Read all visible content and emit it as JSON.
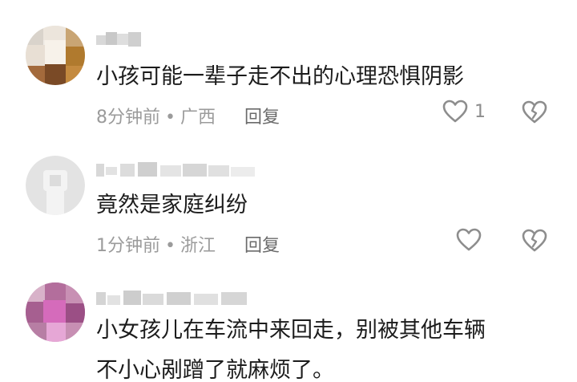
{
  "comments": [
    {
      "text": "小孩可能一辈子走不出的心理恐惧阴影",
      "time": "8分钟前",
      "location": "广西",
      "reply_label": "回复",
      "likes": "1"
    },
    {
      "text": "竟然是家庭纠纷",
      "time": "1分钟前",
      "location": "浙江",
      "reply_label": "回复",
      "likes": ""
    },
    {
      "text_line1": "小女孩儿在车流中来回走，别被其他车辆",
      "text_line2": "不小心剐蹭了就麻烦了。"
    }
  ],
  "separator": "•",
  "icons": {
    "like": "heart-outline-icon",
    "dislike": "broken-heart-icon"
  },
  "colors": {
    "text": "#1c1c1c",
    "meta": "#9b9b9b",
    "icon": "#8d8d8d"
  }
}
